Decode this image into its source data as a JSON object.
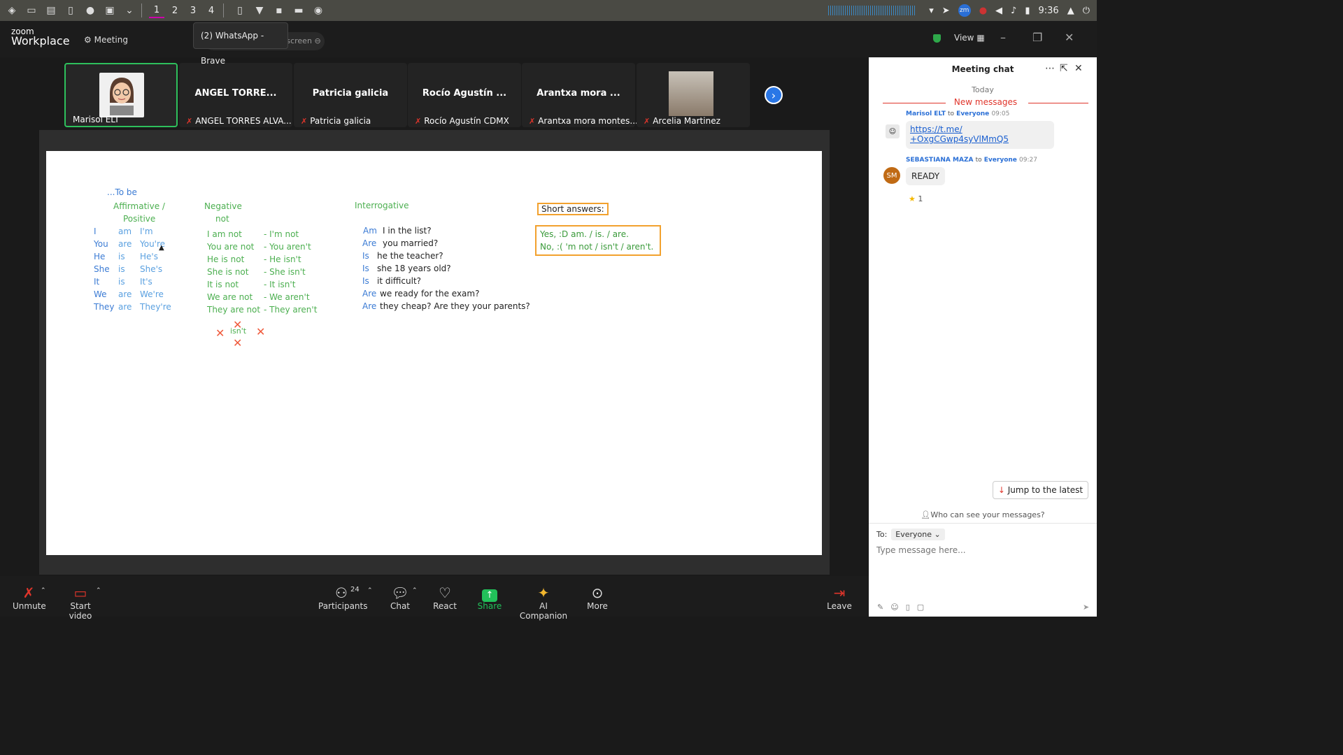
{
  "system_bar": {
    "workspaces": [
      "1",
      "2",
      "3",
      "4"
    ],
    "clock": "9:36",
    "tray_badge": "zm"
  },
  "header": {
    "logo_top": "zoom",
    "logo_bottom": "Workplace",
    "meeting_label": "Meeting",
    "tooltip": "(2) WhatsApp - Brave",
    "share_pill": "Marisol ELT's screen",
    "view_label": "View"
  },
  "thumbnails": [
    {
      "display": "",
      "name": "Marisol ELT",
      "muted": false
    },
    {
      "display": "ANGEL TORRE...",
      "name": "ANGEL TORRES ALVA...",
      "muted": true
    },
    {
      "display": "Patricia galicia",
      "name": "Patricia galicia",
      "muted": true
    },
    {
      "display": "Rocío Agustín ...",
      "name": "Rocío Agustín CDMX",
      "muted": true
    },
    {
      "display": "Arantxa mora ...",
      "name": "Arantxa mora montes...",
      "muted": true
    },
    {
      "display": "",
      "name": "Arcelia Martinez",
      "muted": true
    }
  ],
  "slide": {
    "title": "...To be",
    "affirmative_h1": "Affirmative /",
    "affirmative_h2": "Positive",
    "negative_h1": "Negative",
    "negative_h2": "not",
    "interrogative_h": "Interrogative",
    "pronouns": [
      "I",
      "You",
      "He",
      "She",
      "It",
      "We",
      "They"
    ],
    "verbs": [
      "am",
      "are",
      "is",
      "is",
      "is",
      "are",
      "are"
    ],
    "contractions": [
      "I'm",
      "You're",
      "He's",
      "She's",
      "It's",
      "We're",
      "They're"
    ],
    "negatives": [
      "I am not",
      "You are not",
      "He is not",
      "She is not",
      "It is not",
      "We are not",
      "They are not"
    ],
    "neg_contractions": [
      "- I'm not",
      "- You aren't",
      "- He isn't",
      "- She isn't",
      "- It isn't",
      "- We aren't",
      "- They aren't"
    ],
    "isnt_note": "isn't",
    "q_verbs": [
      "Am",
      "Are",
      "Is",
      "Is",
      "Is",
      "Are",
      "Are"
    ],
    "q_rest": [
      "I in the list?",
      "you married?",
      "he the teacher?",
      "she 18 years old?",
      "it difficult?",
      "we ready for the exam?",
      "they cheap?   Are they your parents?"
    ],
    "short_answers_title": "Short answers:",
    "short_yes": "Yes, :D  am. / is. / are.",
    "short_no": "No, :( 'm not / isn't / aren't."
  },
  "chat": {
    "title": "Meeting chat",
    "today": "Today",
    "new_messages": "New messages",
    "messages": [
      {
        "sender": "Marisol ELT",
        "to": "to",
        "audience": "Everyone",
        "time": "09:05",
        "text_line1": "https://t.me/",
        "text_line2": "+OxgCGwp4syVlMmQ5"
      },
      {
        "sender": "SEBASTIANA MAZA",
        "to": "to",
        "audience": "Everyone",
        "time": "09:27",
        "avatar": "SM",
        "text": "READY"
      }
    ],
    "reaction_count": "1",
    "jump_latest": "Jump to the latest",
    "who_can_see": "Who can see your messages?",
    "to_label": "To:",
    "to_value": "Everyone",
    "input_placeholder": "Type message here..."
  },
  "toolbar": {
    "unmute": "Unmute",
    "start_video": "Start video",
    "participants": "Participants",
    "participants_count": "24",
    "chat": "Chat",
    "react": "React",
    "share": "Share",
    "ai_companion": "AI Companion",
    "more": "More",
    "leave": "Leave"
  }
}
